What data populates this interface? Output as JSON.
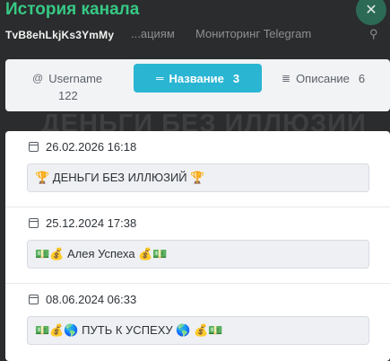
{
  "background": {
    "nav_item_1": "...ациям",
    "nav_item_2": "Мониторинг Telegram",
    "big_text": "ДЕНЬГИ БЕЗ ИЛЛЮЗИЙ"
  },
  "header": {
    "title": "История канала",
    "channel_id": "TvB8ehLkjKs3YmMy",
    "close_label": "✕"
  },
  "tabs": [
    {
      "icon": "@",
      "label": "Username",
      "count": "122",
      "active": false
    },
    {
      "icon": "═",
      "label": "Название",
      "count": "3",
      "active": true
    },
    {
      "icon": "≣",
      "label": "Описание",
      "count": "6",
      "active": false
    }
  ],
  "entries": [
    {
      "date": "26.02.2026 16:18",
      "name": "🏆 ДЕНЬГИ БЕЗ ИЛЛЮЗИЙ 🏆"
    },
    {
      "date": "25.12.2024 17:38",
      "name": "💵💰 Алея Успеха 💰💵"
    },
    {
      "date": "08.06.2024 06:33",
      "name": "💵💰🌎 ПУТЬ К УСПЕХУ 🌎 💰💵"
    }
  ],
  "colors": {
    "title": "#37c985",
    "active_tab": "#2ab5d3",
    "close_button": "#2c6a56"
  }
}
